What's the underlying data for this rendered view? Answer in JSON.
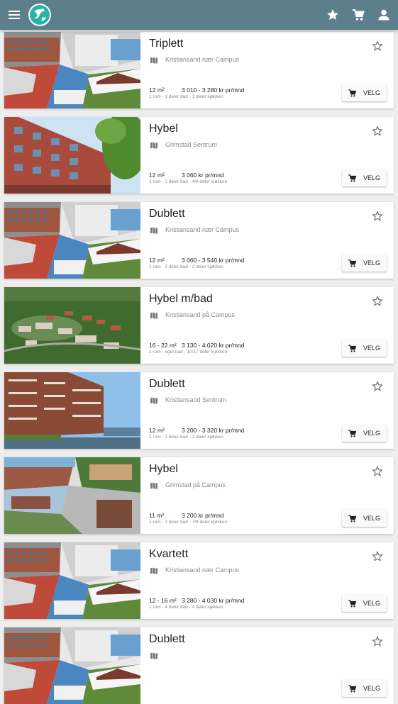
{
  "colors": {
    "appbar": "#5d7f8c",
    "card": "#ffffff",
    "background": "#eeeeee"
  },
  "appbar": {
    "menu_icon": "menu-icon",
    "logo": "sia-logo",
    "actions": [
      "star-icon",
      "cart-icon",
      "account-icon"
    ]
  },
  "button_label": "VELG",
  "listings": [
    {
      "title": "Triplett",
      "location": "Kristiansand nær Campus",
      "area": "12 m²",
      "price": "3 010 - 3 280 kr pr/mnd",
      "details": "1 rom - 3 deler bad - 3 deler kjøkken",
      "image": "collage"
    },
    {
      "title": "Hybel",
      "location": "Grimstad Sentrum",
      "area": "12 m²",
      "price": "3 060 kr pr/mnd",
      "details": "1 rom - 2 deler bad - 4/6 deler kjøkken",
      "image": "building"
    },
    {
      "title": "Dublett",
      "location": "Kristiansand nær Campus",
      "area": "12 m²",
      "price": "3 060 - 3 540 kr pr/mnd",
      "details": "1 rom - 2 deler bad - 2 deler kjøkken",
      "image": "collage"
    },
    {
      "title": "Hybel m/bad",
      "location": "Kristiansand på Campus",
      "area": "16 - 22 m²",
      "price": "3 130 - 4 020 kr pr/mnd",
      "details": "1 rom - eget bad - 10/17 deler kjøkken",
      "image": "aerial"
    },
    {
      "title": "Dublett",
      "location": "Kristiansand Sentrum",
      "area": "12 m²",
      "price": "3 200 - 3 320 kr pr/mnd",
      "details": "1 rom - 2 deler bad - 2 deler kjøkken",
      "image": "brick"
    },
    {
      "title": "Hybel",
      "location": "Grimstad på Campus",
      "area": "11 m²",
      "price": "3 200 kr pr/mnd",
      "details": "1 rom - 2 deler bad - 7/8 deler kjøkken",
      "image": "collage2"
    },
    {
      "title": "Kvartett",
      "location": "Kristiansand nær Campus",
      "area": "12 - 16 m²",
      "price": "3 280 - 4 030 kr pr/mnd",
      "details": "1 rom - 4 deler bad - 4 deler kjøkken",
      "image": "collage"
    },
    {
      "title": "Dublett",
      "location": "",
      "area": "",
      "price": "",
      "details": "",
      "image": "collage"
    }
  ]
}
